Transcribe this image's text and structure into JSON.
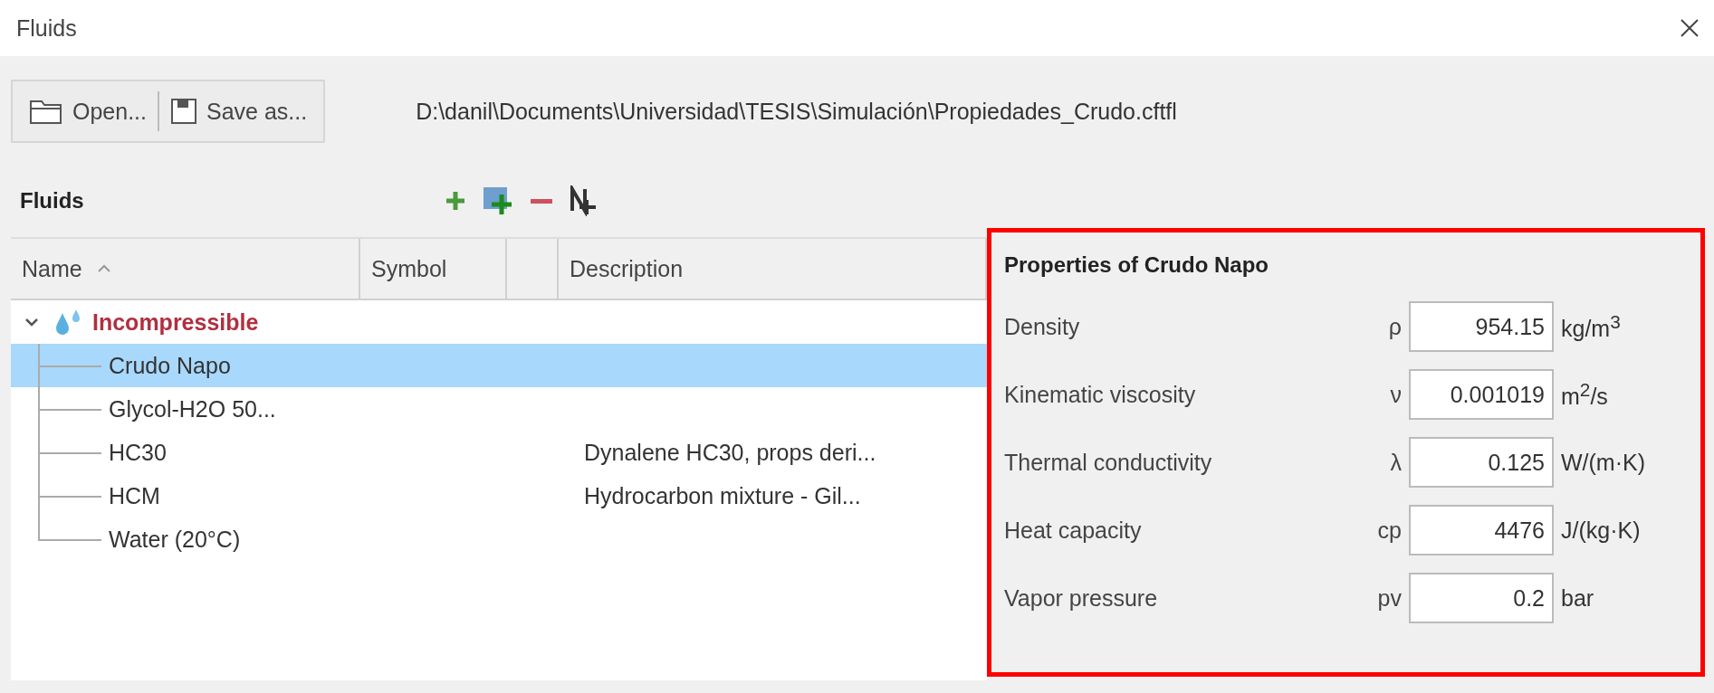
{
  "window": {
    "title": "Fluids"
  },
  "toolbar": {
    "buttons": [
      {
        "label": "Open...",
        "kind": "open"
      },
      {
        "label": "Save as...",
        "kind": "save"
      }
    ],
    "file_path": "D:\\danil\\Documents\\Universidad\\TESIS\\Simulación\\Propiedades_Crudo.cftfl"
  },
  "fluids_header": {
    "title": "Fluids"
  },
  "table": {
    "columns": [
      {
        "label": "Name",
        "sorted": true
      },
      {
        "label": "Symbol"
      },
      {},
      {
        "label": "Description"
      }
    ],
    "tree": [
      {
        "name": "Incompressible",
        "expanded": true,
        "selected": false,
        "children": [
          {
            "name": "Crudo Napo",
            "selected": true
          },
          {
            "name": "Glycol-H2O 50...",
            "selected": false
          },
          {
            "name": "HC30",
            "description": "Dynalene HC30, props deri...",
            "selected": false
          },
          {
            "name": "HCM",
            "description": "Hydrocarbon mixture - Gil...",
            "selected": false
          },
          {
            "name": "Water (20°C)",
            "selected": false
          }
        ]
      }
    ]
  },
  "properties": {
    "title": "Properties of Crudo Napo",
    "highlighted": true,
    "rows": [
      {
        "label": "Density",
        "symbol": "ρ",
        "value": "954.15",
        "unit": "kg/m$^{3}$"
      },
      {
        "label": "Kinematic viscosity",
        "symbol": "ν",
        "value": "0.001019",
        "unit": "m$^{2}$/s"
      },
      {
        "label": "Thermal conductivity",
        "symbol": "λ",
        "value": "0.125",
        "unit": "W/(m·K)"
      },
      {
        "label": "Heat capacity",
        "symbol": "cp",
        "value": "4476",
        "unit": "J/(kg·K)"
      },
      {
        "label": "Vapor pressure",
        "symbol": "pv",
        "value": "0.2",
        "unit": "bar"
      }
    ]
  }
}
